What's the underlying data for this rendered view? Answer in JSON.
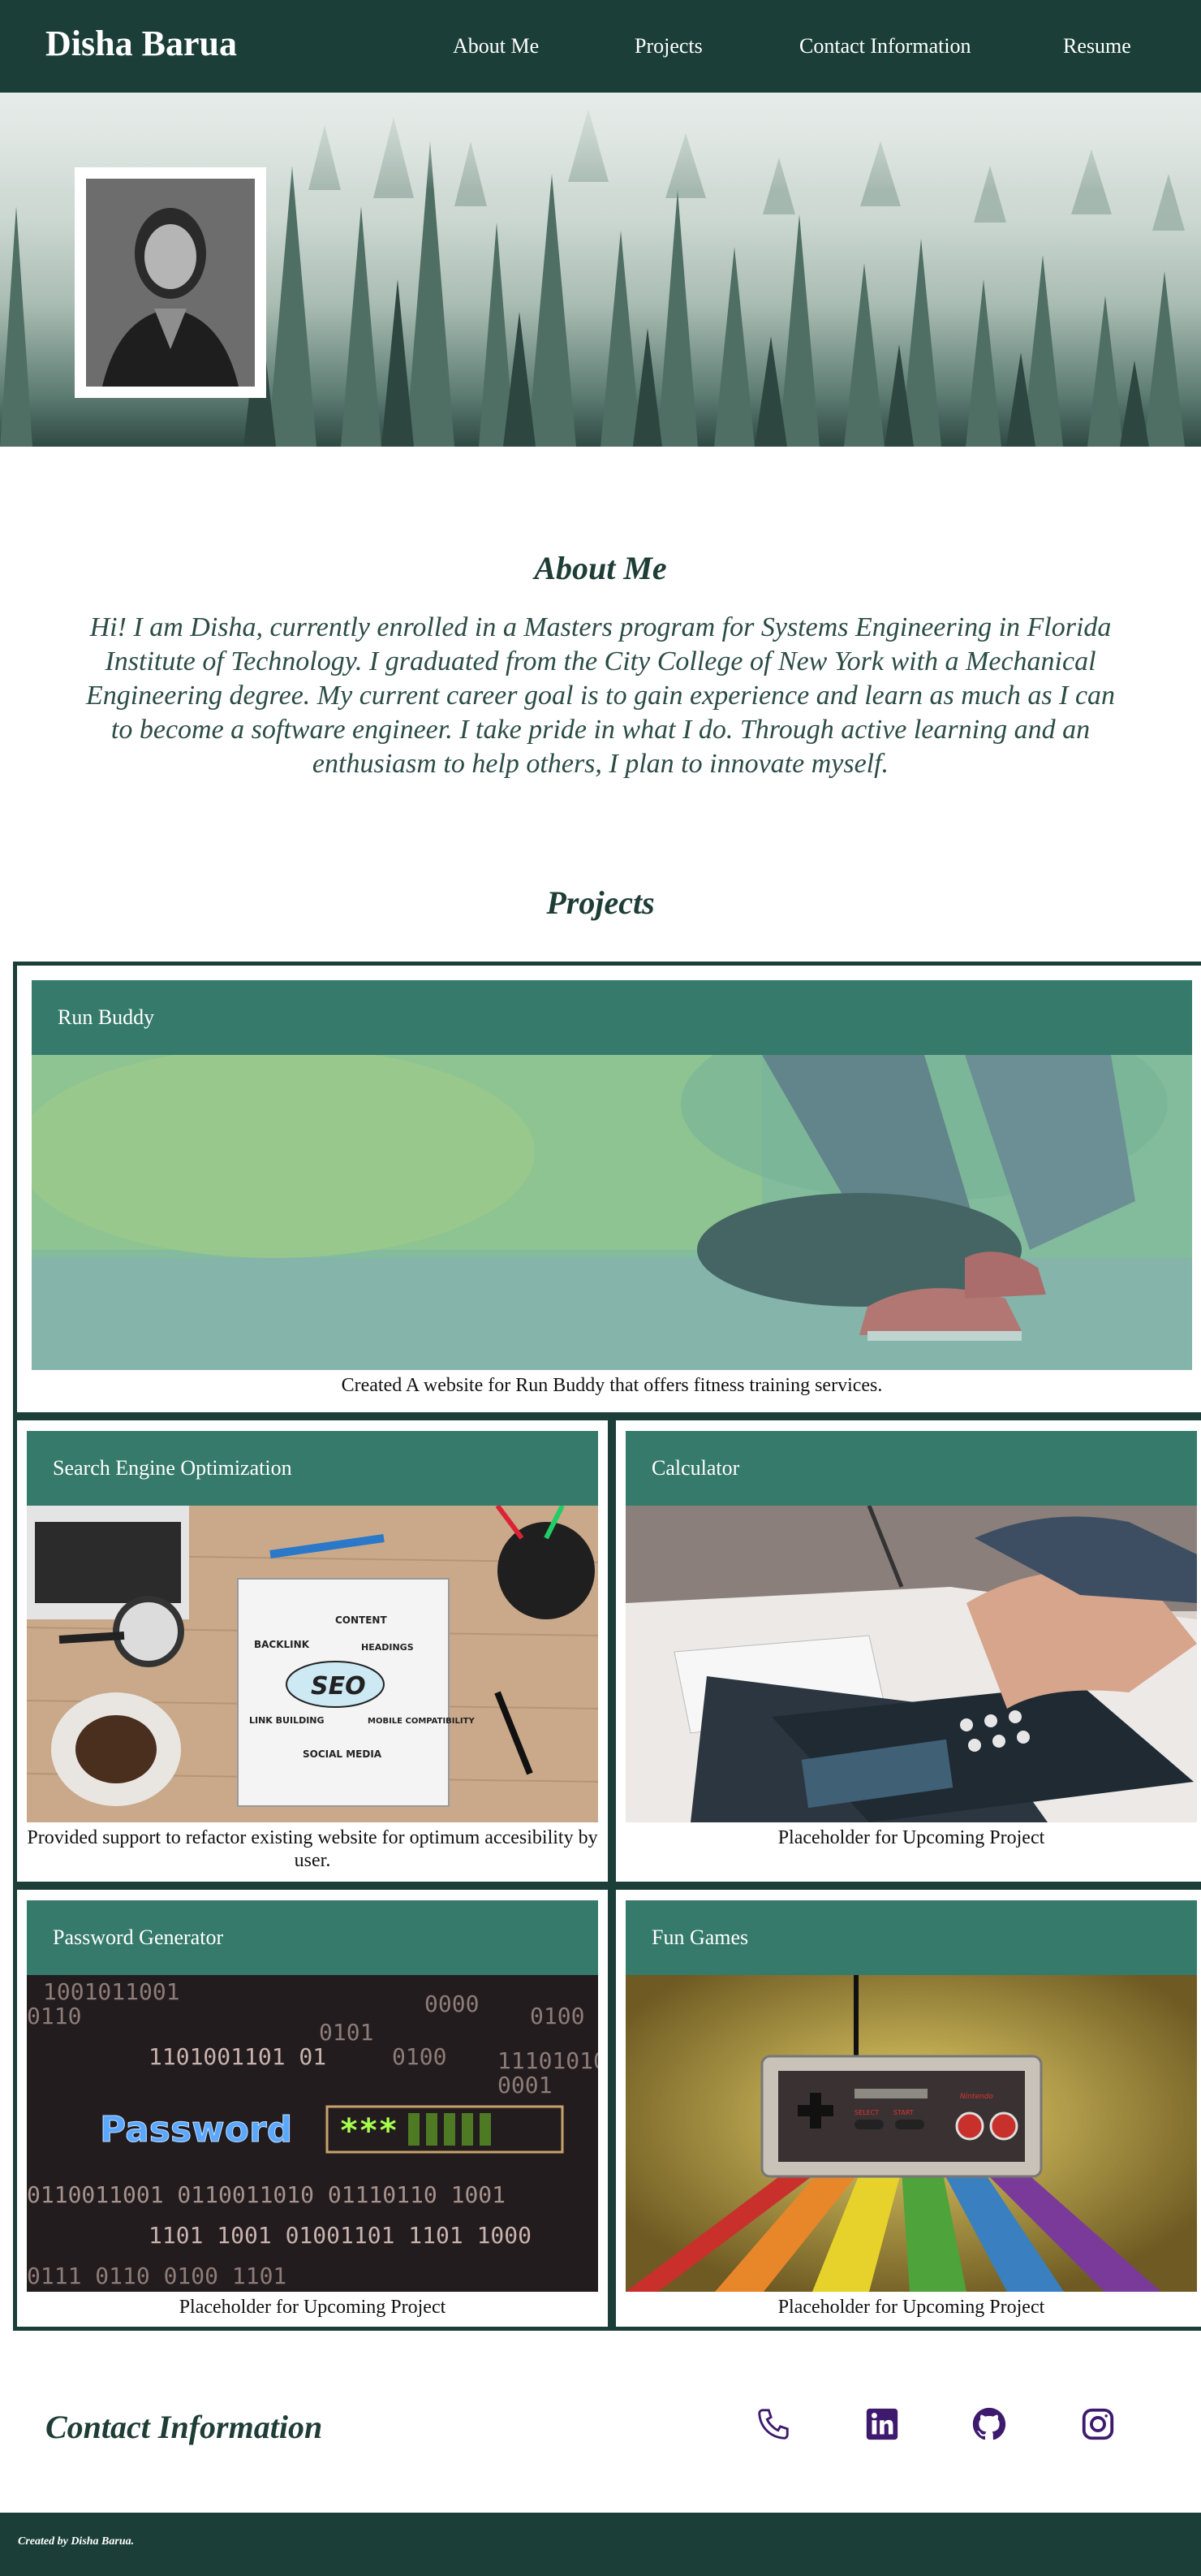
{
  "header": {
    "brand": "Disha Barua",
    "nav": [
      "About Me",
      "Projects",
      "Contact Information",
      "Resume"
    ]
  },
  "about": {
    "title": "About Me",
    "text": "Hi! I am Disha, currently enrolled in a Masters program for Systems Engineering in Florida Institute of Technology. I graduated from the City College of New York with a Mechanical Engineering degree. My current career goal is to gain experience and learn as much as I can to become a software engineer. I take pride in what I do. Through active learning and an enthusiasm to help others, I plan to innovate myself."
  },
  "projects": {
    "title": "Projects",
    "items": [
      {
        "name": "Run Buddy",
        "caption": "Created A website for Run Buddy that offers fitness training services.",
        "image": "running-shoes-photo"
      },
      {
        "name": "Search Engine Optimization",
        "caption": "Provided support to refactor existing website for optimum accesibility by user.",
        "image": "seo-notebook-photo"
      },
      {
        "name": "Calculator",
        "caption": "Placeholder for Upcoming Project",
        "image": "calculator-photo"
      },
      {
        "name": "Password Generator",
        "caption": "Placeholder for Upcoming Project",
        "image": "password-binary-photo"
      },
      {
        "name": "Fun Games",
        "caption": "Placeholder for Upcoming Project",
        "image": "game-controller-photo"
      }
    ],
    "seo_words": [
      "CONTENT",
      "BACKLINK",
      "HEADINGS",
      "SEO",
      "LINK BUILDING",
      "MOBILE COMPATIBILITY",
      "SOCIAL MEDIA"
    ],
    "password_word": "Password",
    "password_mask": "***",
    "binary_lines": [
      "1001011001",
      "0110",
      "0101",
      "0000",
      "0100",
      "1101001101 01",
      "0100",
      "11101010",
      "0001",
      "0110011001 0110011010 01110110 1001",
      "1101 1001 01001101 1101 1000",
      "0111 0110 0100 1101"
    ],
    "controller_labels": [
      "SELECT",
      "START",
      "Nintendo"
    ]
  },
  "contact": {
    "title": "Contact Information",
    "icons": [
      "phone-icon",
      "linkedin-icon",
      "github-icon",
      "instagram-icon"
    ]
  },
  "footer": {
    "text": "Created by Disha Barua."
  },
  "colors": {
    "header": "#1b3f38",
    "card_header": "#357a6a",
    "icon": "#3d1a6e",
    "title": "#1e3d36"
  }
}
